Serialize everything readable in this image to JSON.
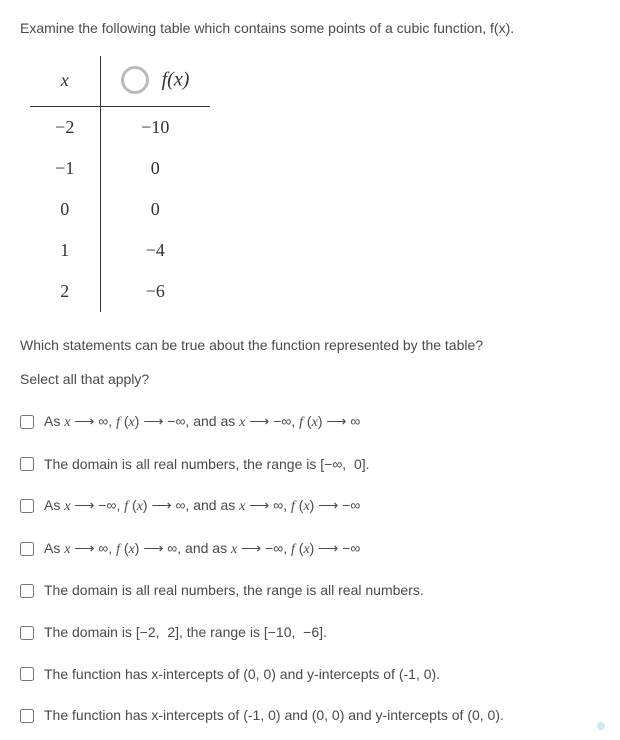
{
  "intro": "Examine the following table which contains some points of a cubic function, f(x).",
  "table": {
    "header_x": "x",
    "header_fx": "f(x)",
    "rows": [
      {
        "x": "−2",
        "fx": "−10"
      },
      {
        "x": "−1",
        "fx": "0"
      },
      {
        "x": "0",
        "fx": "0"
      },
      {
        "x": "1",
        "fx": "−4"
      },
      {
        "x": "2",
        "fx": "−6"
      }
    ]
  },
  "question": "Which statements can be true about the function represented by the table?",
  "select_prompt": "Select all that apply?",
  "options": [
    "As x ⟶ ∞, f (x) ⟶ −∞, and as x ⟶ −∞, f (x) ⟶ ∞",
    "The domain is all real numbers, the range is [−∞, 0].",
    "As x ⟶ −∞, f (x) ⟶ ∞, and as x ⟶ ∞, f (x) ⟶ −∞",
    "As x ⟶ ∞, f (x) ⟶ ∞, and as x ⟶ −∞, f (x) ⟶ −∞",
    "The domain is all real numbers, the range is all real numbers.",
    "The domain is [−2, 2], the range is [−10, −6].",
    "The function has x-intercepts of (0, 0) and y-intercepts of (-1, 0).",
    "The function has x-intercepts of (-1, 0) and (0, 0) and y-intercepts of (0, 0)."
  ]
}
